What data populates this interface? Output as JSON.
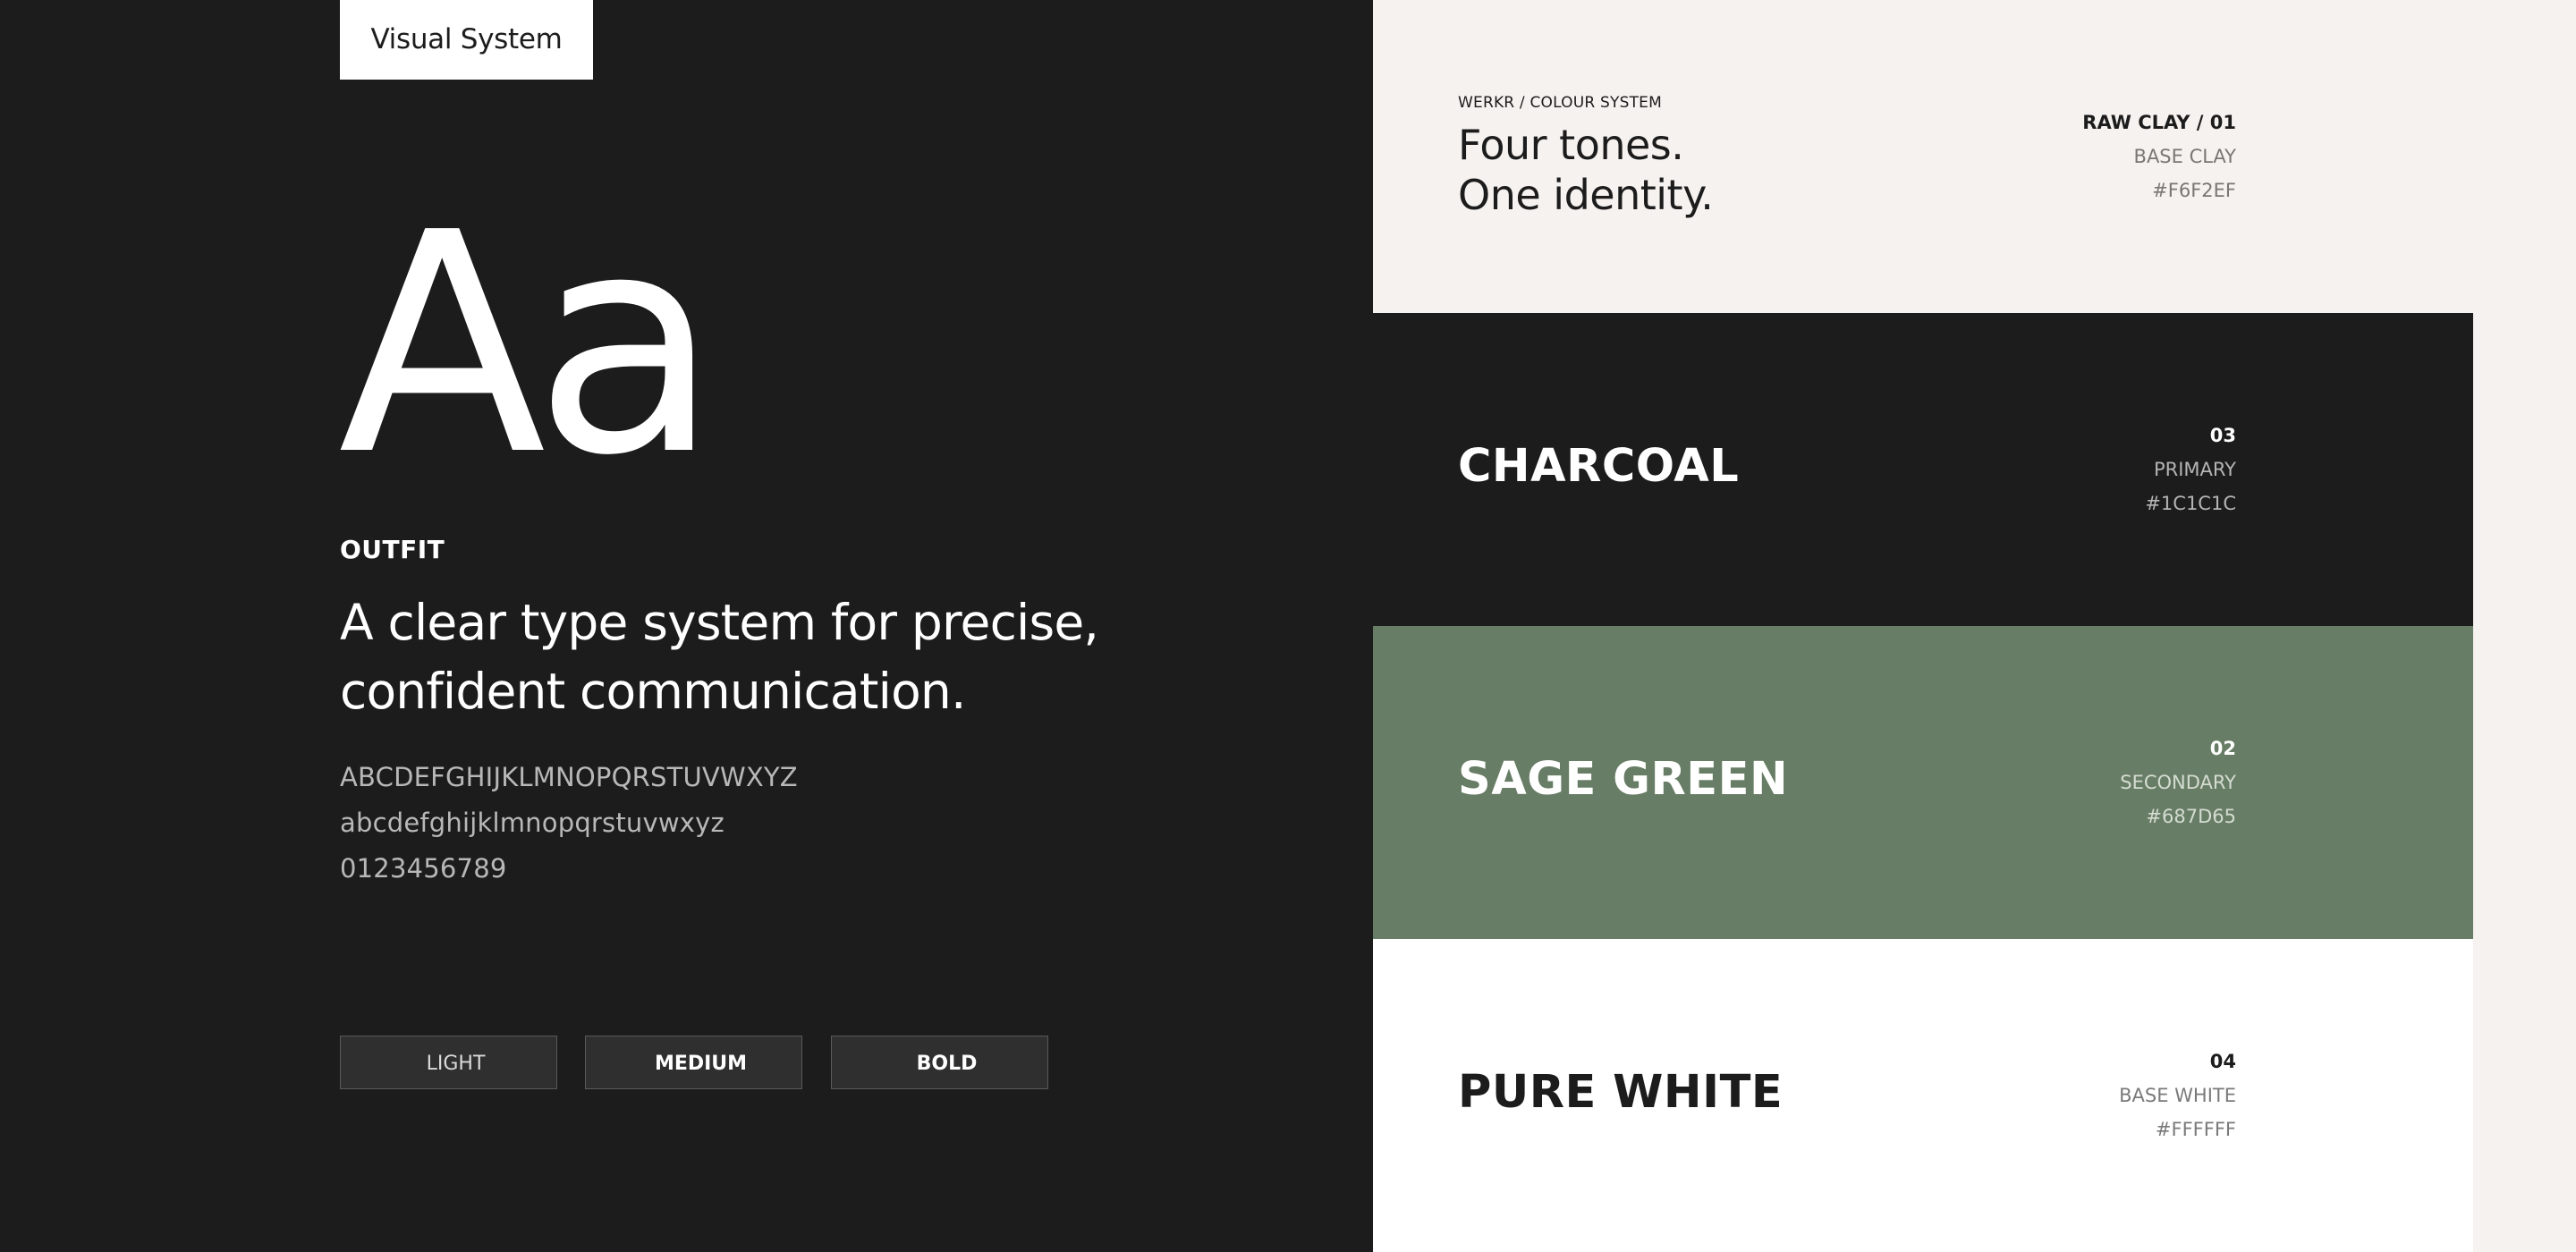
{
  "typography": {
    "tag_label": "Visual System",
    "specimen": "Aa",
    "font_name": "OUTFIT",
    "tagline_line1": "A clear type system for precise,",
    "tagline_line2": "confident communication.",
    "uppercase": "ABCDEFGHIJKLMNOPQRSTUVWXYZ",
    "lowercase": "abcdefghijklmnopqrstuvwxyz",
    "digits": "0123456789",
    "weights": [
      "LIGHT",
      "MEDIUM",
      "BOLD"
    ]
  },
  "colour_system": {
    "eyebrow": "WERKR / COLOUR SYSTEM",
    "headline_line1": "Four tones.",
    "headline_line2": "One identity.",
    "swatches": [
      {
        "code": "RAW CLAY / 01",
        "role": "BASE CLAY",
        "hex": "#F6F2EF"
      },
      {
        "name": "CHARCOAL",
        "code": "03",
        "role": "PRIMARY",
        "hex": "#1C1C1C"
      },
      {
        "name": "SAGE GREEN",
        "code": "02",
        "role": "SECONDARY",
        "hex": "#687D65"
      },
      {
        "name": "PURE WHITE",
        "code": "04",
        "role": "BASE WHITE",
        "hex": "#FFFFFF"
      }
    ]
  },
  "colors": {
    "raw_clay": "#F6F2EF",
    "charcoal": "#1C1C1C",
    "sage_green": "#687D65",
    "pure_white": "#FFFFFF"
  }
}
